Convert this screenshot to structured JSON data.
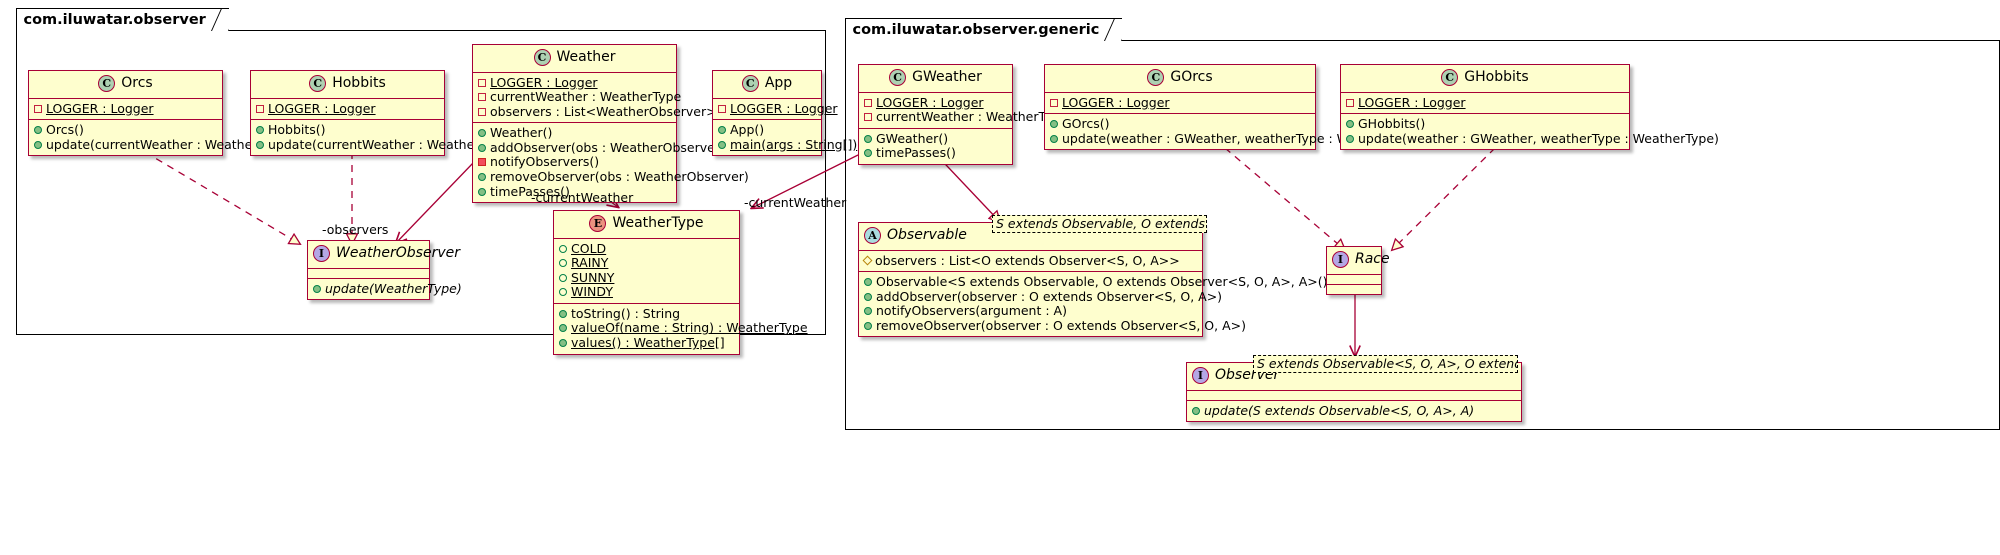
{
  "diagram": {
    "type": "uml-class-diagram",
    "colors": {
      "class_fill": "#fefece",
      "class_border": "#a80036",
      "line": "#a80036",
      "package_border": "#000000",
      "stereotype_class": "#add1b2",
      "stereotype_interface": "#b4a7e5",
      "stereotype_enum": "#eb937f",
      "stereotype_abstract": "#a9dcdf",
      "background": "#ffffff"
    }
  },
  "packages": [
    {
      "name": "com.iluwatar.observer"
    },
    {
      "name": "com.iluwatar.observer.generic"
    }
  ],
  "classes": {
    "orcs": {
      "stereotype": "C",
      "name": "Orcs",
      "fields": [
        {
          "visibility": "private",
          "text": "LOGGER : Logger",
          "static": true
        }
      ],
      "methods": [
        {
          "visibility": "public",
          "text": "Orcs()",
          "static": false
        },
        {
          "visibility": "public",
          "text": "update(currentWeather : WeatherType)",
          "static": false
        }
      ]
    },
    "hobbits": {
      "stereotype": "C",
      "name": "Hobbits",
      "fields": [
        {
          "visibility": "private",
          "text": "LOGGER : Logger",
          "static": true
        }
      ],
      "methods": [
        {
          "visibility": "public",
          "text": "Hobbits()",
          "static": false
        },
        {
          "visibility": "public",
          "text": "update(currentWeather : WeatherType)",
          "static": false
        }
      ]
    },
    "weather": {
      "stereotype": "C",
      "name": "Weather",
      "fields": [
        {
          "visibility": "private",
          "text": "LOGGER : Logger",
          "static": true
        },
        {
          "visibility": "private",
          "text": "currentWeather : WeatherType",
          "static": false
        },
        {
          "visibility": "private",
          "text": "observers : List<WeatherObserver>",
          "static": false
        }
      ],
      "methods": [
        {
          "visibility": "public",
          "text": "Weather()",
          "static": false
        },
        {
          "visibility": "public",
          "text": "addObserver(obs : WeatherObserver)",
          "static": false
        },
        {
          "visibility": "private",
          "text": "notifyObservers()",
          "static": false
        },
        {
          "visibility": "public",
          "text": "removeObserver(obs : WeatherObserver)",
          "static": false
        },
        {
          "visibility": "public",
          "text": "timePasses()",
          "static": false
        }
      ]
    },
    "app": {
      "stereotype": "C",
      "name": "App",
      "fields": [
        {
          "visibility": "private",
          "text": "LOGGER : Logger",
          "static": true
        }
      ],
      "methods": [
        {
          "visibility": "public",
          "text": "App()",
          "static": false
        },
        {
          "visibility": "public",
          "text": "main(args : String[])",
          "static": true
        }
      ]
    },
    "weather_observer": {
      "stereotype": "I",
      "name": "WeatherObserver",
      "italic_name": true,
      "fields": [],
      "methods": [
        {
          "visibility": "public",
          "text": "update(WeatherType)",
          "static": false,
          "italic": true
        }
      ]
    },
    "weather_type": {
      "stereotype": "E",
      "name": "WeatherType",
      "fields": [
        {
          "visibility": "enum",
          "text": "COLD",
          "static": true
        },
        {
          "visibility": "enum",
          "text": "RAINY",
          "static": true
        },
        {
          "visibility": "enum",
          "text": "SUNNY",
          "static": true
        },
        {
          "visibility": "enum",
          "text": "WINDY",
          "static": true
        }
      ],
      "methods": [
        {
          "visibility": "public",
          "text": "toString() : String",
          "static": false
        },
        {
          "visibility": "public",
          "text": "valueOf(name : String) : WeatherType",
          "static": true
        },
        {
          "visibility": "public",
          "text": "values() : WeatherType[]",
          "static": true
        }
      ]
    },
    "gweather": {
      "stereotype": "C",
      "name": "GWeather",
      "fields": [
        {
          "visibility": "private",
          "text": "LOGGER : Logger",
          "static": true
        },
        {
          "visibility": "private",
          "text": "currentWeather : WeatherType",
          "static": false
        }
      ],
      "methods": [
        {
          "visibility": "public",
          "text": "GWeather()",
          "static": false
        },
        {
          "visibility": "public",
          "text": "timePasses()",
          "static": false
        }
      ]
    },
    "gorcs": {
      "stereotype": "C",
      "name": "GOrcs",
      "fields": [
        {
          "visibility": "private",
          "text": "LOGGER : Logger",
          "static": true
        }
      ],
      "methods": [
        {
          "visibility": "public",
          "text": "GOrcs()",
          "static": false
        },
        {
          "visibility": "public",
          "text": "update(weather : GWeather, weatherType : WeatherType)",
          "static": false
        }
      ]
    },
    "ghobbits": {
      "stereotype": "C",
      "name": "GHobbits",
      "fields": [
        {
          "visibility": "private",
          "text": "LOGGER : Logger",
          "static": true
        }
      ],
      "methods": [
        {
          "visibility": "public",
          "text": "GHobbits()",
          "static": false
        },
        {
          "visibility": "public",
          "text": "update(weather : GWeather, weatherType : WeatherType)",
          "static": false
        }
      ]
    },
    "observable": {
      "stereotype": "A",
      "name": "Observable",
      "italic_name": true,
      "generic_params": "S extends Observable, O extends Observer<S, O, A>, A",
      "fields": [
        {
          "visibility": "protected",
          "text": "observers : List<O extends Observer<S, O, A>>",
          "static": false
        }
      ],
      "methods": [
        {
          "visibility": "public",
          "text": "Observable<S extends Observable, O extends Observer<S, O, A>, A>()",
          "static": false
        },
        {
          "visibility": "public",
          "text": "addObserver(observer : O extends Observer<S, O, A>)",
          "static": false
        },
        {
          "visibility": "public",
          "text": "notifyObservers(argument : A)",
          "static": false
        },
        {
          "visibility": "public",
          "text": "removeObserver(observer : O extends Observer<S, O, A>)",
          "static": false
        }
      ]
    },
    "race": {
      "stereotype": "I",
      "name": "Race",
      "italic_name": true,
      "fields": [],
      "methods": []
    },
    "observer": {
      "stereotype": "I",
      "name": "Observer",
      "italic_name": true,
      "generic_params": "S extends Observable<S, O, A>, O extends Observer, A",
      "fields": [],
      "methods": [
        {
          "visibility": "public",
          "text": "update(S extends Observable<S, O, A>, A)",
          "static": false,
          "italic": true
        }
      ]
    }
  },
  "edge_labels": {
    "observers": "-observers",
    "current_weather_left": "-currentWeather",
    "current_weather_right": "-currentWeather"
  }
}
